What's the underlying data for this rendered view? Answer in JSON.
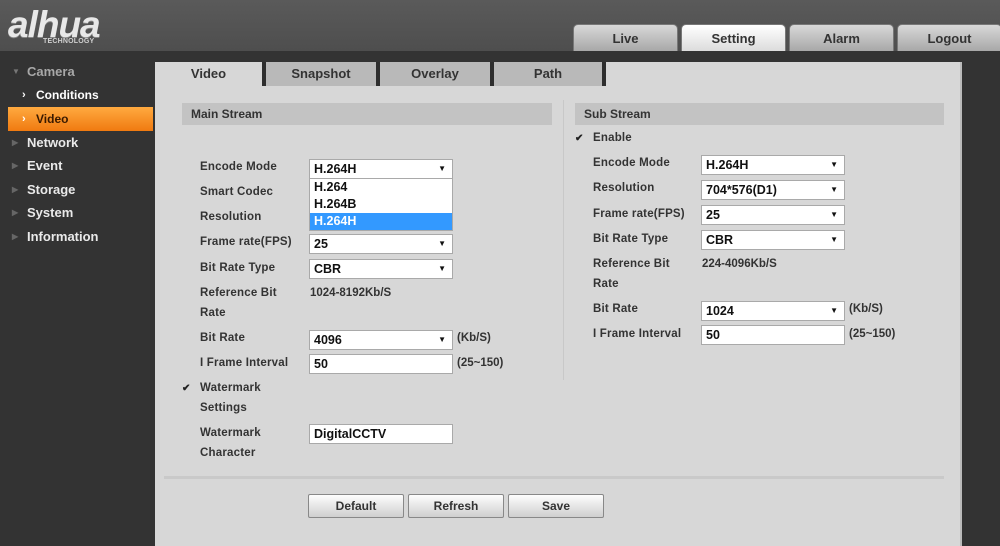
{
  "header": {
    "logo_brand": "alhua",
    "logo_tagline": "TECHNOLOGY",
    "nav": [
      {
        "label": "Live",
        "active": false
      },
      {
        "label": "Setting",
        "active": true
      },
      {
        "label": "Alarm",
        "active": false
      },
      {
        "label": "Logout",
        "active": false
      }
    ]
  },
  "sidebar": {
    "camera": {
      "label": "Camera",
      "expanded": true
    },
    "camera_children": [
      {
        "label": "Conditions",
        "active": false
      },
      {
        "label": "Video",
        "active": true
      }
    ],
    "items": [
      {
        "label": "Network"
      },
      {
        "label": "Event"
      },
      {
        "label": "Storage"
      },
      {
        "label": "System"
      },
      {
        "label": "Information"
      }
    ]
  },
  "tabs": [
    {
      "label": "Video",
      "active": true
    },
    {
      "label": "Snapshot",
      "active": false
    },
    {
      "label": "Overlay",
      "active": false
    },
    {
      "label": "Path",
      "active": false
    }
  ],
  "main_stream": {
    "title": "Main Stream",
    "encode_mode": {
      "label": "Encode Mode",
      "value": "H.264H",
      "options": [
        "H.264",
        "H.264B",
        "H.264H"
      ],
      "highlighted": "H.264H"
    },
    "smart_codec": {
      "label": "Smart Codec"
    },
    "resolution": {
      "label": "Resolution"
    },
    "frame_rate": {
      "label": "Frame rate(FPS)",
      "value": "25"
    },
    "bit_rate_type": {
      "label": "Bit Rate Type",
      "value": "CBR"
    },
    "reference_bit_rate": {
      "label_line1": "Reference Bit",
      "label_line2": "Rate",
      "value": "1024-8192Kb/S"
    },
    "bit_rate": {
      "label": "Bit Rate",
      "value": "4096",
      "unit": "(Kb/S)"
    },
    "i_frame_interval": {
      "label": "I Frame Interval",
      "value": "50",
      "range": "(25~150)"
    },
    "watermark_settings": {
      "label_line1": "Watermark",
      "label_line2": "Settings",
      "checked": true
    },
    "watermark_character": {
      "label_line1": "Watermark",
      "label_line2": "Character",
      "value": "DigitalCCTV"
    }
  },
  "sub_stream": {
    "title": "Sub Stream",
    "enable": {
      "label": "Enable",
      "checked": true
    },
    "encode_mode": {
      "label": "Encode Mode",
      "value": "H.264H"
    },
    "resolution": {
      "label": "Resolution",
      "value": "704*576(D1)"
    },
    "frame_rate": {
      "label": "Frame rate(FPS)",
      "value": "25"
    },
    "bit_rate_type": {
      "label": "Bit Rate Type",
      "value": "CBR"
    },
    "reference_bit_rate": {
      "label_line1": "Reference Bit",
      "label_line2": "Rate",
      "value": "224-4096Kb/S"
    },
    "bit_rate": {
      "label": "Bit Rate",
      "value": "1024",
      "unit": "(Kb/S)"
    },
    "i_frame_interval": {
      "label": "I Frame Interval",
      "value": "50",
      "range": "(25~150)"
    }
  },
  "buttons": {
    "default": "Default",
    "refresh": "Refresh",
    "save": "Save"
  },
  "icons": {
    "check": "✔",
    "caret": "▼",
    "chevron": "›",
    "triangle_right": "▶",
    "triangle_down": "▼"
  }
}
